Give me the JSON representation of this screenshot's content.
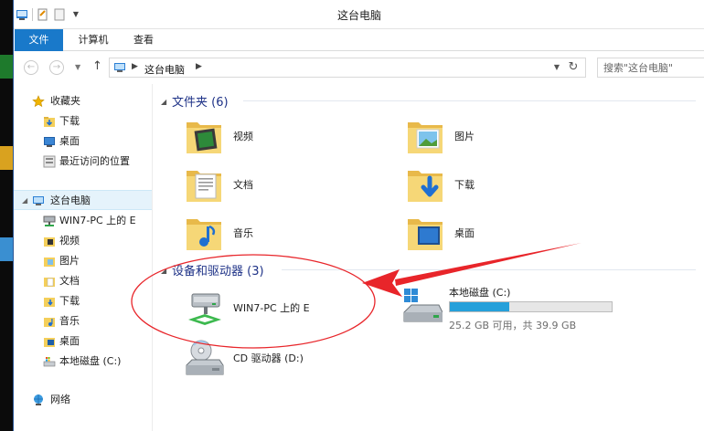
{
  "window": {
    "title": "这台电脑"
  },
  "ribbon": {
    "tabs": [
      {
        "label": "文件"
      },
      {
        "label": "计算机"
      },
      {
        "label": "查看"
      }
    ]
  },
  "address": {
    "crumb": "这台电脑",
    "search_placeholder": "搜索\"这台电脑\""
  },
  "nav": {
    "favorites": {
      "label": "收藏夹"
    },
    "favorites_items": [
      {
        "label": "下载",
        "icon": "download-folder-icon"
      },
      {
        "label": "桌面",
        "icon": "desktop-icon"
      },
      {
        "label": "最近访问的位置",
        "icon": "recent-places-icon"
      }
    ],
    "this_pc": {
      "label": "这台电脑"
    },
    "pc_items": [
      {
        "label": "WIN7-PC 上的 E",
        "icon": "network-drive-icon"
      },
      {
        "label": "视频",
        "icon": "videos-folder-icon"
      },
      {
        "label": "图片",
        "icon": "pictures-folder-icon"
      },
      {
        "label": "文档",
        "icon": "documents-folder-icon"
      },
      {
        "label": "下载",
        "icon": "download-folder-icon"
      },
      {
        "label": "音乐",
        "icon": "music-folder-icon"
      },
      {
        "label": "桌面",
        "icon": "desktop-folder-icon"
      },
      {
        "label": "本地磁盘 (C:)",
        "icon": "local-disk-icon"
      }
    ],
    "network": {
      "label": "网络"
    }
  },
  "content": {
    "folders_header": "文件夹 (6)",
    "folders": [
      {
        "label": "视频",
        "icon": "videos-folder-icon"
      },
      {
        "label": "图片",
        "icon": "pictures-folder-icon"
      },
      {
        "label": "文档",
        "icon": "documents-folder-icon"
      },
      {
        "label": "下载",
        "icon": "downloads-folder-icon"
      },
      {
        "label": "音乐",
        "icon": "music-folder-icon"
      },
      {
        "label": "桌面",
        "icon": "desktop-folder-icon"
      }
    ],
    "devices_header": "设备和驱动器 (3)",
    "network_drive": {
      "label": "WIN7-PC 上的 E"
    },
    "local_disk": {
      "label": "本地磁盘 (C:)",
      "space": "25.2 GB 可用，共 39.9 GB",
      "used_fraction": 0.368
    },
    "cd_drive": {
      "label": "CD 驱动器 (D:)"
    }
  },
  "colors": {
    "accent": "#1979ca",
    "header_text": "#1e3287",
    "annotation": "#e8252a",
    "drive_fill": "#26a0da"
  }
}
